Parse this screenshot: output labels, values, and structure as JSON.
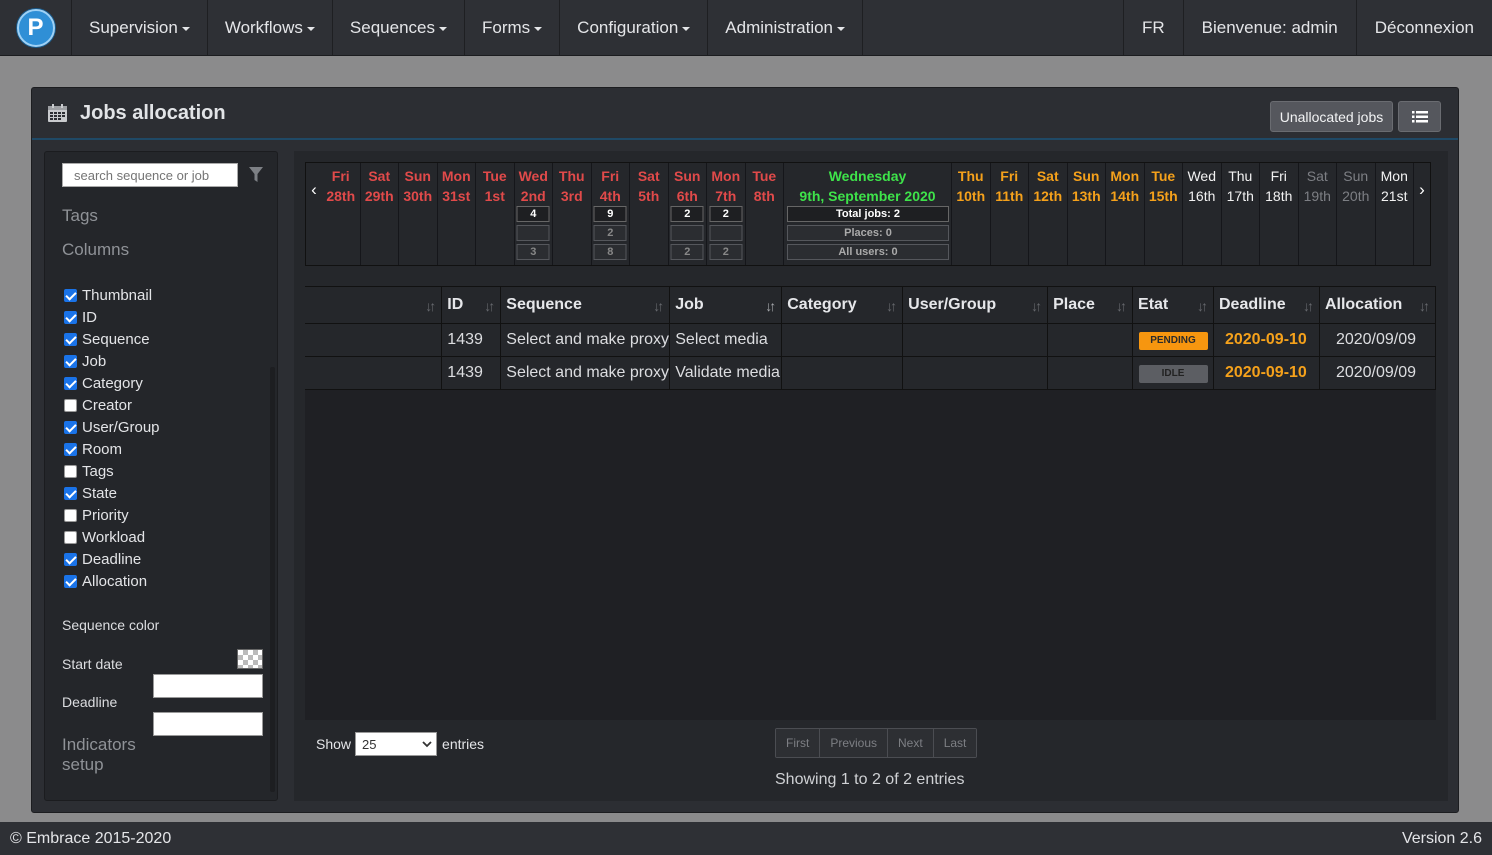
{
  "logo": {
    "letter": "P"
  },
  "nav": {
    "menus": [
      "Supervision",
      "Workflows",
      "Sequences",
      "Forms",
      "Configuration",
      "Administration"
    ],
    "lang": "FR",
    "welcome": "Bienvenue: admin",
    "logout": "Déconnexion"
  },
  "card": {
    "title": "Jobs allocation",
    "unallocated_button": "Unallocated jobs"
  },
  "sidebar": {
    "search_placeholder": "search sequence or job",
    "tags_label": "Tags",
    "columns_label": "Columns",
    "columns": [
      {
        "label": "Thumbnail",
        "checked": true
      },
      {
        "label": "ID",
        "checked": true
      },
      {
        "label": "Sequence",
        "checked": true
      },
      {
        "label": "Job",
        "checked": true
      },
      {
        "label": "Category",
        "checked": true
      },
      {
        "label": "Creator",
        "checked": false
      },
      {
        "label": "User/Group",
        "checked": true
      },
      {
        "label": "Room",
        "checked": true
      },
      {
        "label": "Tags",
        "checked": false
      },
      {
        "label": "State",
        "checked": true
      },
      {
        "label": "Priority",
        "checked": false
      },
      {
        "label": "Workload",
        "checked": false
      },
      {
        "label": "Deadline",
        "checked": true
      },
      {
        "label": "Allocation",
        "checked": true
      }
    ],
    "sequence_color_label": "Sequence color",
    "start_date_label": "Start date",
    "deadline_label": "Deadline",
    "indicators_label_1": "Indicators",
    "indicators_label_2": "setup"
  },
  "calendar": {
    "days": [
      {
        "d": "Fri",
        "n": "28th",
        "kind": "past",
        "counts": []
      },
      {
        "d": "Sat",
        "n": "29th",
        "kind": "past",
        "counts": []
      },
      {
        "d": "Sun",
        "n": "30th",
        "kind": "past",
        "counts": []
      },
      {
        "d": "Mon",
        "n": "31st",
        "kind": "past",
        "counts": []
      },
      {
        "d": "Tue",
        "n": "1st",
        "kind": "past",
        "counts": []
      },
      {
        "d": "Wed",
        "n": "2nd",
        "kind": "past",
        "counts": [
          "4",
          "",
          "3"
        ]
      },
      {
        "d": "Thu",
        "n": "3rd",
        "kind": "past",
        "counts": []
      },
      {
        "d": "Fri",
        "n": "4th",
        "kind": "past",
        "counts": [
          "9",
          "2",
          "8"
        ]
      },
      {
        "d": "Sat",
        "n": "5th",
        "kind": "past",
        "counts": []
      },
      {
        "d": "Sun",
        "n": "6th",
        "kind": "past",
        "counts": [
          "2",
          "",
          "2"
        ]
      },
      {
        "d": "Mon",
        "n": "7th",
        "kind": "past",
        "counts": [
          "2",
          "",
          "2"
        ]
      },
      {
        "d": "Tue",
        "n": "8th",
        "kind": "past",
        "counts": []
      },
      {
        "d": "Wednesday",
        "n": "9th, September 2020",
        "kind": "today",
        "counts": [
          "Total jobs: 2",
          "Places: 0",
          "All users: 0"
        ]
      },
      {
        "d": "Thu",
        "n": "10th",
        "kind": "future",
        "counts": []
      },
      {
        "d": "Fri",
        "n": "11th",
        "kind": "future",
        "counts": []
      },
      {
        "d": "Sat",
        "n": "12th",
        "kind": "future",
        "counts": []
      },
      {
        "d": "Sun",
        "n": "13th",
        "kind": "future",
        "counts": []
      },
      {
        "d": "Mon",
        "n": "14th",
        "kind": "future",
        "counts": []
      },
      {
        "d": "Tue",
        "n": "15th",
        "kind": "future",
        "counts": []
      },
      {
        "d": "Wed",
        "n": "16th",
        "kind": "normal",
        "counts": []
      },
      {
        "d": "Thu",
        "n": "17th",
        "kind": "normal",
        "counts": []
      },
      {
        "d": "Fri",
        "n": "18th",
        "kind": "normal",
        "counts": []
      },
      {
        "d": "Sat",
        "n": "19th",
        "kind": "weekend",
        "counts": []
      },
      {
        "d": "Sun",
        "n": "20th",
        "kind": "weekend",
        "counts": []
      },
      {
        "d": "Mon",
        "n": "21st",
        "kind": "normal",
        "counts": []
      }
    ]
  },
  "table": {
    "headers": [
      "",
      "ID",
      "Sequence",
      "Job",
      "Category",
      "User/Group",
      "Place",
      "Etat",
      "Deadline",
      "Allocation"
    ],
    "rows": [
      {
        "id": "1439",
        "sequence": "Select and make proxy",
        "job": "Select media",
        "category": "",
        "user": "",
        "place": "",
        "state": "PENDING",
        "deadline": "2020-09-10",
        "allocation": "2020/09/09"
      },
      {
        "id": "1439",
        "sequence": "Select and make proxy",
        "job": "Validate media",
        "category": "",
        "user": "",
        "place": "",
        "state": "IDLE",
        "deadline": "2020-09-10",
        "allocation": "2020/09/09"
      }
    ]
  },
  "pagination": {
    "show_label": "Show",
    "page_size": "25",
    "entries_label": "entries",
    "first": "First",
    "previous": "Previous",
    "next": "Next",
    "last": "Last",
    "info": "Showing 1 to 2 of 2 entries"
  },
  "footer": {
    "copyright": "© Embrace 2015-2020",
    "version": "Version 2.6"
  },
  "colors": {
    "accent": "#2f8fd6",
    "past_day": "#e14a4a",
    "future_day": "#f5a11b",
    "today": "#3ee34a",
    "pending": "#f7960f"
  }
}
